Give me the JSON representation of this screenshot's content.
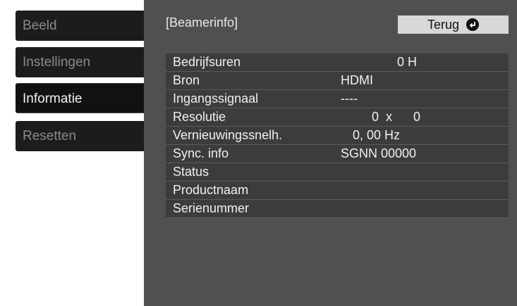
{
  "menu": {
    "items": [
      {
        "label": "Beeld",
        "active": false
      },
      {
        "label": "Instellingen",
        "active": false
      },
      {
        "label": "Informatie",
        "active": true
      },
      {
        "label": "Resetten",
        "active": false
      }
    ]
  },
  "panel": {
    "title": "[Beamerinfo]",
    "back_label": "Terug",
    "back_icon": "enter-return-icon"
  },
  "info": {
    "rows": [
      {
        "label": "Bedrijfsuren",
        "value": "0 H"
      },
      {
        "label": "Bron",
        "value": "HDMI"
      },
      {
        "label": "Ingangssignaal",
        "value": "----"
      },
      {
        "label": "Resolutie",
        "value": "0  x      0"
      },
      {
        "label": "Vernieuwingssnelh.",
        "value": "0, 00 Hz"
      },
      {
        "label": "Sync. info",
        "value": "SGNN 00000"
      },
      {
        "label": "Status",
        "value": ""
      },
      {
        "label": "Productnaam",
        "value": ""
      },
      {
        "label": "Serienummer",
        "value": ""
      }
    ]
  },
  "colors": {
    "panel_bg": "#505050",
    "menu_bg": "#1c1c1c",
    "table_bg": "#3c3c3c",
    "button_bg": "#d8d8d8"
  }
}
